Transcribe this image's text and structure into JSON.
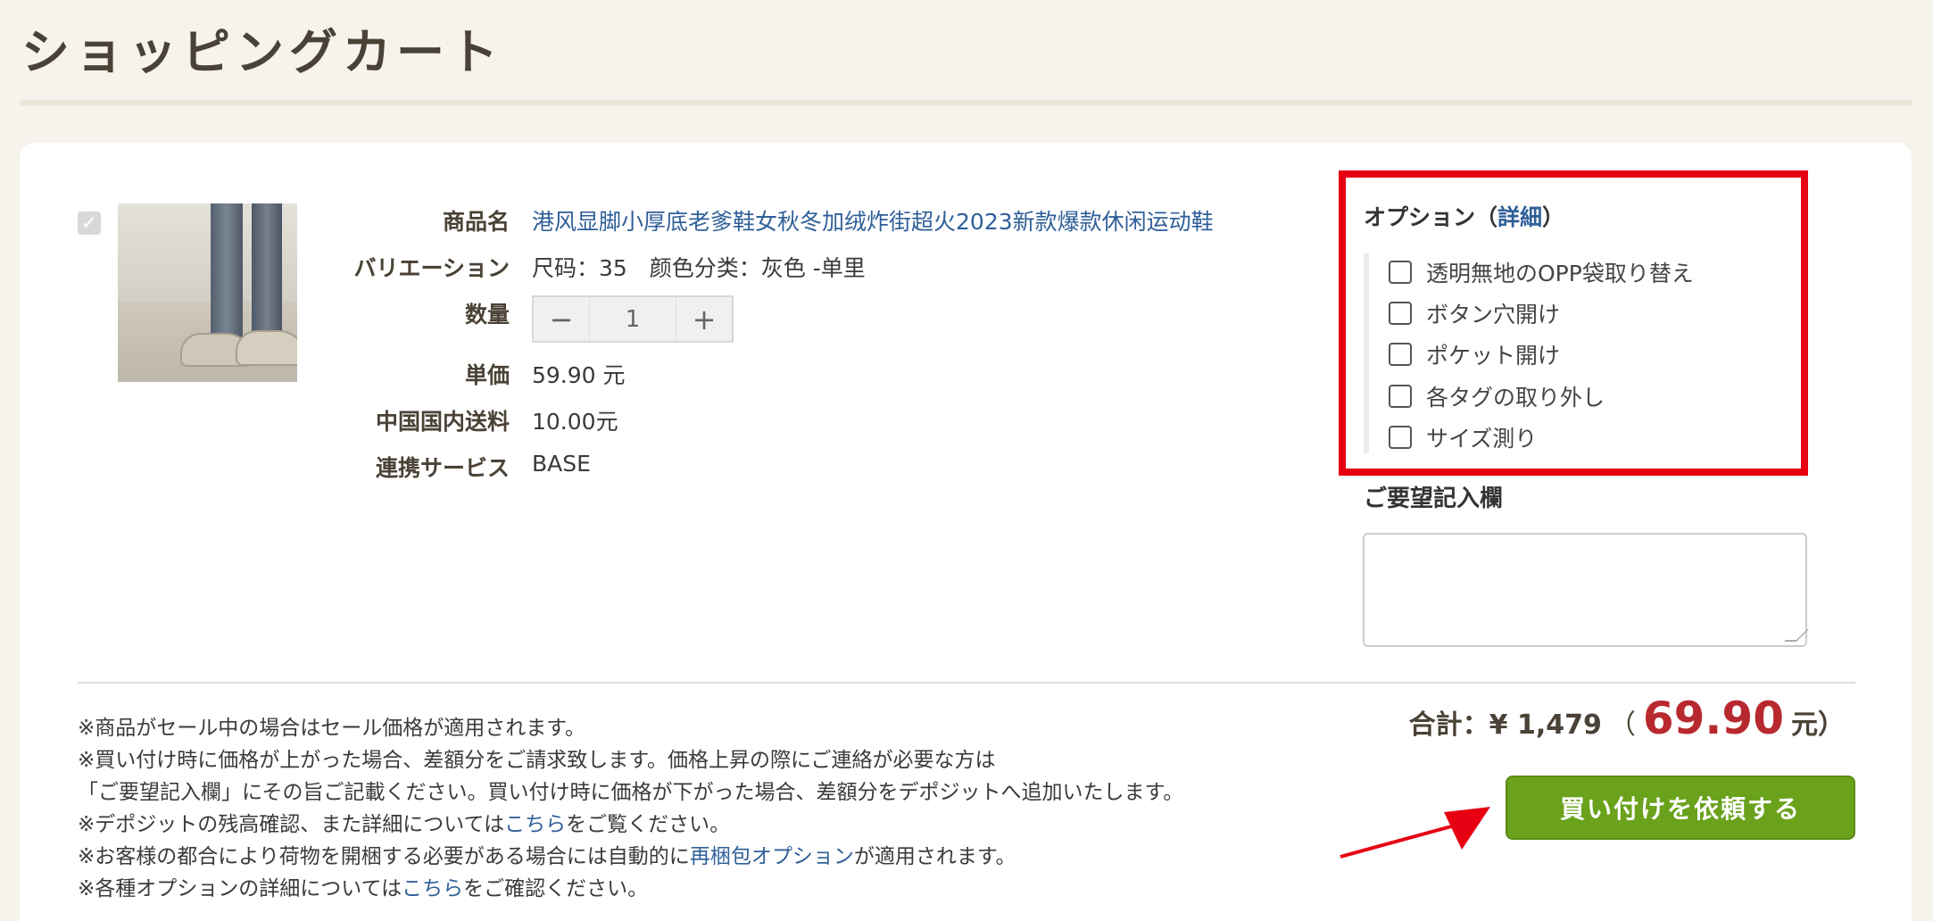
{
  "page_title": "ショッピングカート",
  "item": {
    "checked": true,
    "image_alt": "product-shoes",
    "specs": [
      {
        "label": "商品名",
        "value": "港风显脚小厚底老爹鞋女秋冬加绒炸街超火2023新款爆款休闲运动鞋"
      },
      {
        "label": "バリエーション",
        "value": "尺码：35　颜色分类：灰色 -单里"
      },
      {
        "label": "数量",
        "value": "1"
      },
      {
        "label": "単価",
        "value": "59.90 元"
      },
      {
        "label": "中国国内送料",
        "value": "10.00元"
      },
      {
        "label": "連携サービス",
        "value": "BASE"
      }
    ],
    "qty_minus": "−",
    "qty_plus": "+"
  },
  "options": {
    "title_prefix": "オプション（",
    "detail_link": "詳細",
    "title_suffix": "）",
    "items": [
      {
        "label": "透明無地のOPP袋取り替え",
        "checked": false
      },
      {
        "label": "ボタン穴開け",
        "checked": false
      },
      {
        "label": "ポケット開け",
        "checked": false
      },
      {
        "label": "各タグの取り外し",
        "checked": false
      },
      {
        "label": "サイズ測り",
        "checked": false
      }
    ]
  },
  "request": {
    "label": "ご要望記入欄",
    "value": ""
  },
  "notes": {
    "line1": "※商品がセール中の場合はセール価格が適用されます。",
    "line2": "※買い付け時に価格が上がった場合、差額分をご請求致します。価格上昇の際にご連絡が必要な方は",
    "line3": "「ご要望記入欄」にその旨ご記載ください。買い付け時に価格が下がった場合、差額分をデポジットへ追加いたします。",
    "line4_pre": "※デポジットの残高確認、また詳細については",
    "line4_link": "こちら",
    "line4_post": "をご覧ください。",
    "line5_pre": "※お客様の都合により荷物を開梱する必要がある場合には自動的に",
    "line5_link": "再梱包オプション",
    "line5_post": "が適用されます。",
    "line6_pre": "※各種オプションの詳細については",
    "line6_link": "こちら",
    "line6_post": "をご確認ください。"
  },
  "total": {
    "label": "合計：¥ 1,479",
    "paren_open": "（",
    "amount": "69.90",
    "unit": "元）"
  },
  "buy_button": "買い付けを依頼する",
  "colors": {
    "highlight_box": "#e60012",
    "buy_button": "#6aa21c",
    "total_amount": "#b8292f",
    "link": "#2f5f98"
  }
}
